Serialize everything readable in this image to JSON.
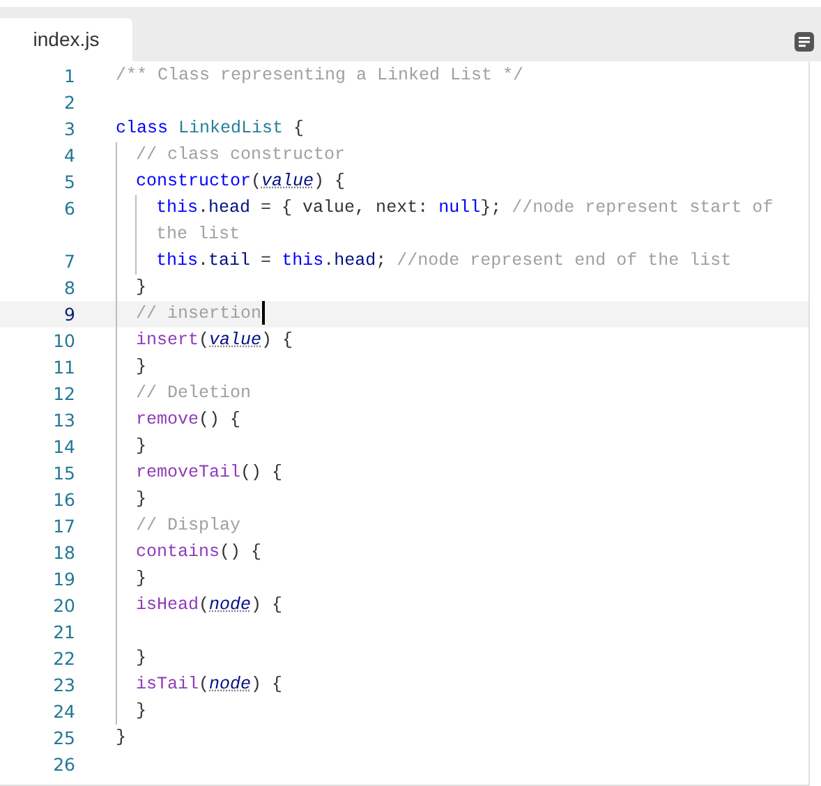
{
  "tabs": [
    {
      "label": "index.js",
      "selected": true
    }
  ],
  "lines": [
    {
      "number": "1",
      "current": false,
      "tokens": [
        {
          "kind": "comment",
          "text": "/** Class representing a Linked List */"
        }
      ]
    },
    {
      "number": "2",
      "current": false
    },
    {
      "number": "3",
      "current": false,
      "tokens": [
        {
          "kind": "keyword",
          "text": "class"
        },
        {
          "kind": "type",
          "text": " LinkedList"
        },
        {
          "kind": "plain",
          "text": " {"
        }
      ]
    },
    {
      "number": "4",
      "current": false,
      "tokens": [
        {
          "kind": "comment",
          "text": "  // class constructor"
        }
      ]
    },
    {
      "number": "5",
      "current": false,
      "tokens": [
        {
          "kind": "keyword",
          "text": "  constructor"
        },
        {
          "kind": "plain",
          "text": "("
        },
        {
          "kind": "param",
          "text": "value"
        },
        {
          "kind": "plain",
          "text": ") {"
        }
      ]
    },
    {
      "number": "6",
      "current": false,
      "tokens": [
        {
          "kind": "keyword",
          "text": "    this"
        },
        {
          "kind": "plain",
          "text": "."
        },
        {
          "kind": "property",
          "text": "head"
        },
        {
          "kind": "plain",
          "text": " = { value, next: "
        },
        {
          "kind": "keyword",
          "text": "null"
        },
        {
          "kind": "plain",
          "text": "}; "
        },
        {
          "kind": "comment",
          "text": "//node represent start of the list"
        }
      ]
    },
    {
      "number": "7",
      "current": false,
      "tokens": [
        {
          "kind": "keyword",
          "text": "    this"
        },
        {
          "kind": "plain",
          "text": "."
        },
        {
          "kind": "property",
          "text": "tail"
        },
        {
          "kind": "plain",
          "text": " = "
        },
        {
          "kind": "keyword",
          "text": "this"
        },
        {
          "kind": "plain",
          "text": "."
        },
        {
          "kind": "property",
          "text": "head"
        },
        {
          "kind": "plain",
          "text": "; "
        },
        {
          "kind": "comment",
          "text": "//node represent end of the list"
        }
      ]
    },
    {
      "number": "8",
      "current": false,
      "tokens": [
        {
          "kind": "plain",
          "text": "  }"
        }
      ]
    },
    {
      "number": "9",
      "current": true,
      "tokens": [
        {
          "kind": "comment",
          "text": "  // insertion"
        }
      ]
    },
    {
      "number": "10",
      "current": false,
      "tokens": [
        {
          "kind": "function",
          "text": "  insert"
        },
        {
          "kind": "plain",
          "text": "("
        },
        {
          "kind": "param",
          "text": "value"
        },
        {
          "kind": "plain",
          "text": ") {"
        }
      ]
    },
    {
      "number": "11",
      "current": false,
      "tokens": [
        {
          "kind": "plain",
          "text": "  }"
        }
      ]
    },
    {
      "number": "12",
      "current": false,
      "tokens": [
        {
          "kind": "comment",
          "text": "  // Deletion"
        }
      ]
    },
    {
      "number": "13",
      "current": false,
      "tokens": [
        {
          "kind": "function",
          "text": "  remove"
        },
        {
          "kind": "plain",
          "text": "() {"
        }
      ]
    },
    {
      "number": "14",
      "current": false,
      "tokens": [
        {
          "kind": "plain",
          "text": "  }"
        }
      ]
    },
    {
      "number": "15",
      "current": false,
      "tokens": [
        {
          "kind": "function",
          "text": "  removeTail"
        },
        {
          "kind": "plain",
          "text": "() {"
        }
      ]
    },
    {
      "number": "16",
      "current": false,
      "tokens": [
        {
          "kind": "plain",
          "text": "  }"
        }
      ]
    },
    {
      "number": "17",
      "current": false,
      "tokens": [
        {
          "kind": "comment",
          "text": "  // Display"
        }
      ]
    },
    {
      "number": "18",
      "current": false,
      "tokens": [
        {
          "kind": "function",
          "text": "  contains"
        },
        {
          "kind": "plain",
          "text": "() {"
        }
      ]
    },
    {
      "number": "19",
      "current": false,
      "tokens": [
        {
          "kind": "plain",
          "text": "  }"
        }
      ]
    },
    {
      "number": "20",
      "current": false,
      "tokens": [
        {
          "kind": "function",
          "text": "  isHead"
        },
        {
          "kind": "plain",
          "text": "("
        },
        {
          "kind": "param",
          "text": "node"
        },
        {
          "kind": "plain",
          "text": ") {"
        }
      ]
    },
    {
      "number": "21",
      "current": false
    },
    {
      "number": "22",
      "current": false,
      "tokens": [
        {
          "kind": "plain",
          "text": "  }"
        }
      ]
    },
    {
      "number": "23",
      "current": false,
      "tokens": [
        {
          "kind": "function",
          "text": "  isTail"
        },
        {
          "kind": "plain",
          "text": "("
        },
        {
          "kind": "param",
          "text": "node"
        },
        {
          "kind": "plain",
          "text": ") {"
        }
      ]
    },
    {
      "number": "24",
      "current": false,
      "tokens": [
        {
          "kind": "plain",
          "text": "  }"
        }
      ]
    },
    {
      "number": "25",
      "current": false,
      "tokens": [
        {
          "kind": "plain",
          "text": "}"
        }
      ]
    },
    {
      "number": "26",
      "current": false
    }
  ]
}
